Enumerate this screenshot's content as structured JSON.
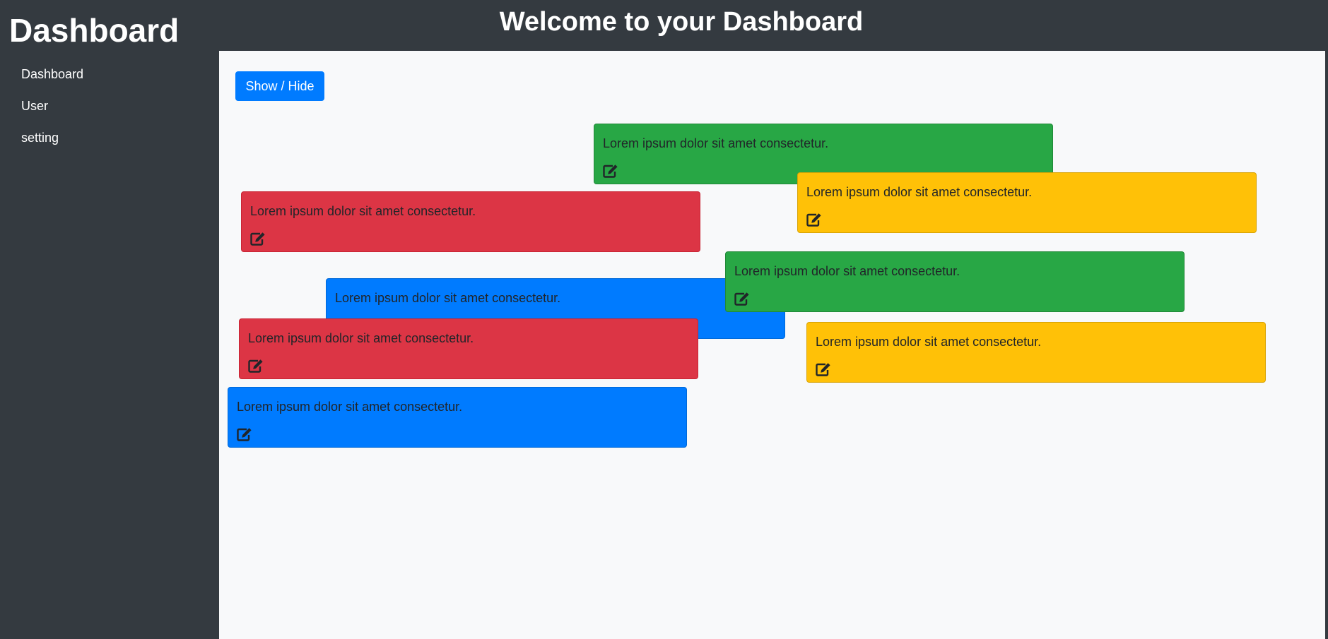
{
  "sidebar": {
    "brand": "Dashboard",
    "items": [
      {
        "label": "Dashboard"
      },
      {
        "label": "User"
      },
      {
        "label": "setting"
      }
    ]
  },
  "header": {
    "title": "Welcome to your Dashboard"
  },
  "main": {
    "toggle_label": "Show / Hide",
    "cards": [
      {
        "text": "Lorem ipsum dolor sit amet consectetur.",
        "color": "green",
        "icon": "edit-icon"
      },
      {
        "text": "Lorem ipsum dolor sit amet consectetur.",
        "color": "yellow",
        "icon": "edit-icon"
      },
      {
        "text": "Lorem ipsum dolor sit amet consectetur.",
        "color": "red",
        "icon": "edit-icon"
      },
      {
        "text": "Lorem ipsum dolor sit amet consectetur.",
        "color": "blue",
        "icon": "edit-icon"
      },
      {
        "text": "Lorem ipsum dolor sit amet consectetur.",
        "color": "green",
        "icon": "edit-icon"
      },
      {
        "text": "Lorem ipsum dolor sit amet consectetur.",
        "color": "red",
        "icon": "edit-icon"
      },
      {
        "text": "Lorem ipsum dolor sit amet consectetur.",
        "color": "yellow",
        "icon": "edit-icon"
      },
      {
        "text": "Lorem ipsum dolor sit amet consectetur.",
        "color": "blue",
        "icon": "edit-icon"
      }
    ]
  },
  "colors": {
    "green": "#28a745",
    "yellow": "#ffc107",
    "red": "#dc3545",
    "blue": "#007bff",
    "sidebar": "#343a40",
    "content_bg": "#f8f9fa"
  }
}
